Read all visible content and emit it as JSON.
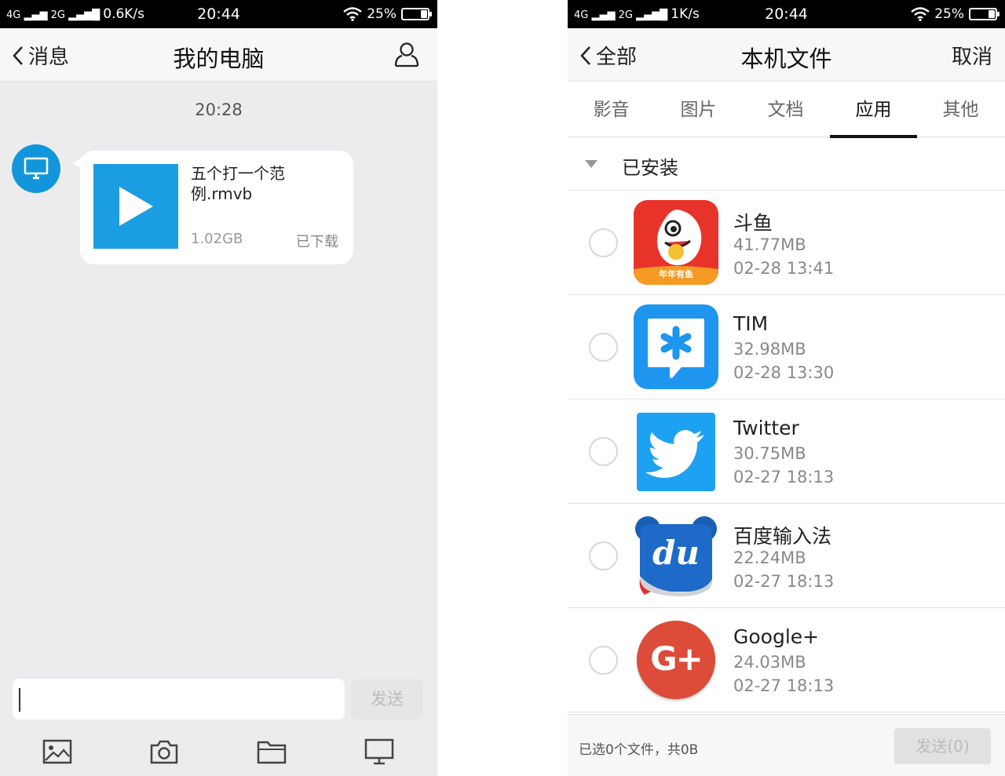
{
  "left": {
    "status": {
      "net1": "4G",
      "net2": "2G",
      "speed": "0.6K/s",
      "time": "20:44",
      "battery": "25%"
    },
    "nav": {
      "back_label": "消息",
      "title": "我的电脑"
    },
    "chat": {
      "time": "20:28",
      "file": {
        "name": "五个打一个范例.rmvb",
        "size": "1.02GB",
        "status": "已下载"
      }
    },
    "input": {
      "value": "",
      "send_label": "发送"
    },
    "toolbar": [
      "image-icon",
      "camera-icon",
      "folder-icon",
      "computer-icon"
    ]
  },
  "right": {
    "status": {
      "net1": "4G",
      "net2": "2G",
      "speed": "1K/s",
      "time": "20:44",
      "battery": "25%"
    },
    "nav": {
      "back_label": "全部",
      "title": "本机文件",
      "cancel_label": "取消"
    },
    "tabs": [
      "影音",
      "图片",
      "文档",
      "应用",
      "其他"
    ],
    "active_tab": "应用",
    "section": "已安装",
    "apps": [
      {
        "name": "斗鱼",
        "size": "41.77MB",
        "date": "02-28 13:41",
        "icon_text": "年年有鱼"
      },
      {
        "name": "TIM",
        "size": "32.98MB",
        "date": "02-28 13:30"
      },
      {
        "name": "Twitter",
        "size": "30.75MB",
        "date": "02-27 18:13"
      },
      {
        "name": "百度输入法",
        "size": "22.24MB",
        "date": "02-27 18:13",
        "icon_text": "du"
      },
      {
        "name": "Google+",
        "size": "24.03MB",
        "date": "02-27 18:13",
        "icon_text": "G+"
      }
    ],
    "footer": {
      "info": "已选0个文件，共0B",
      "send_label": "发送(0)"
    }
  },
  "colors": {
    "accent_blue": "#1296db",
    "douyu_red": "#e8332a",
    "tim_blue": "#1e95ee",
    "twitter_blue": "#1da1f2",
    "gplus_red": "#dd4b39"
  },
  "battery_level": 0.25
}
